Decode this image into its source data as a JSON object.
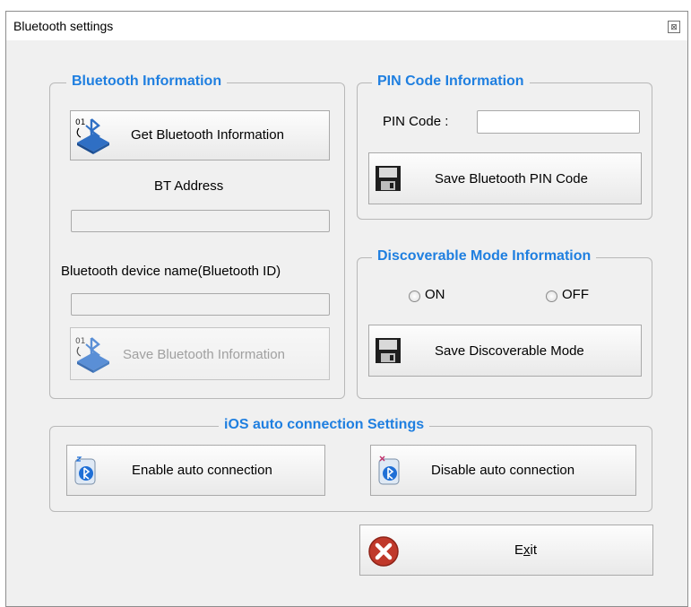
{
  "window": {
    "title": "Bluetooth settings",
    "close_glyph": "⊠"
  },
  "bt_info": {
    "legend": "Bluetooth Information",
    "get_button": "Get Bluetooth Information",
    "address_label": "BT Address",
    "address_value": "",
    "name_label": "Bluetooth device name(Bluetooth ID)",
    "name_value": "",
    "save_button": "Save Bluetooth Information",
    "icon_text": "01"
  },
  "pin": {
    "legend": "PIN Code Information",
    "label": "PIN Code :",
    "value": "",
    "save_button": "Save Bluetooth PIN Code"
  },
  "discoverable": {
    "legend": "Discoverable Mode Information",
    "on_label": "ON",
    "off_label": "OFF",
    "save_button": "Save Discoverable Mode"
  },
  "ios": {
    "legend": "iOS auto connection Settings",
    "enable_button": "Enable auto connection",
    "disable_button": "Disable auto connection"
  },
  "exit": {
    "label_pre": "E",
    "label_underline": "x",
    "label_post": "it"
  },
  "colors": {
    "legend": "#1f7fe0",
    "background": "#f0f0f0",
    "exit_icon": "#c0392b"
  },
  "icons": [
    "bluetooth-info-icon",
    "floppy-disk-icon",
    "bluetooth-phone-icon",
    "exit-icon"
  ]
}
